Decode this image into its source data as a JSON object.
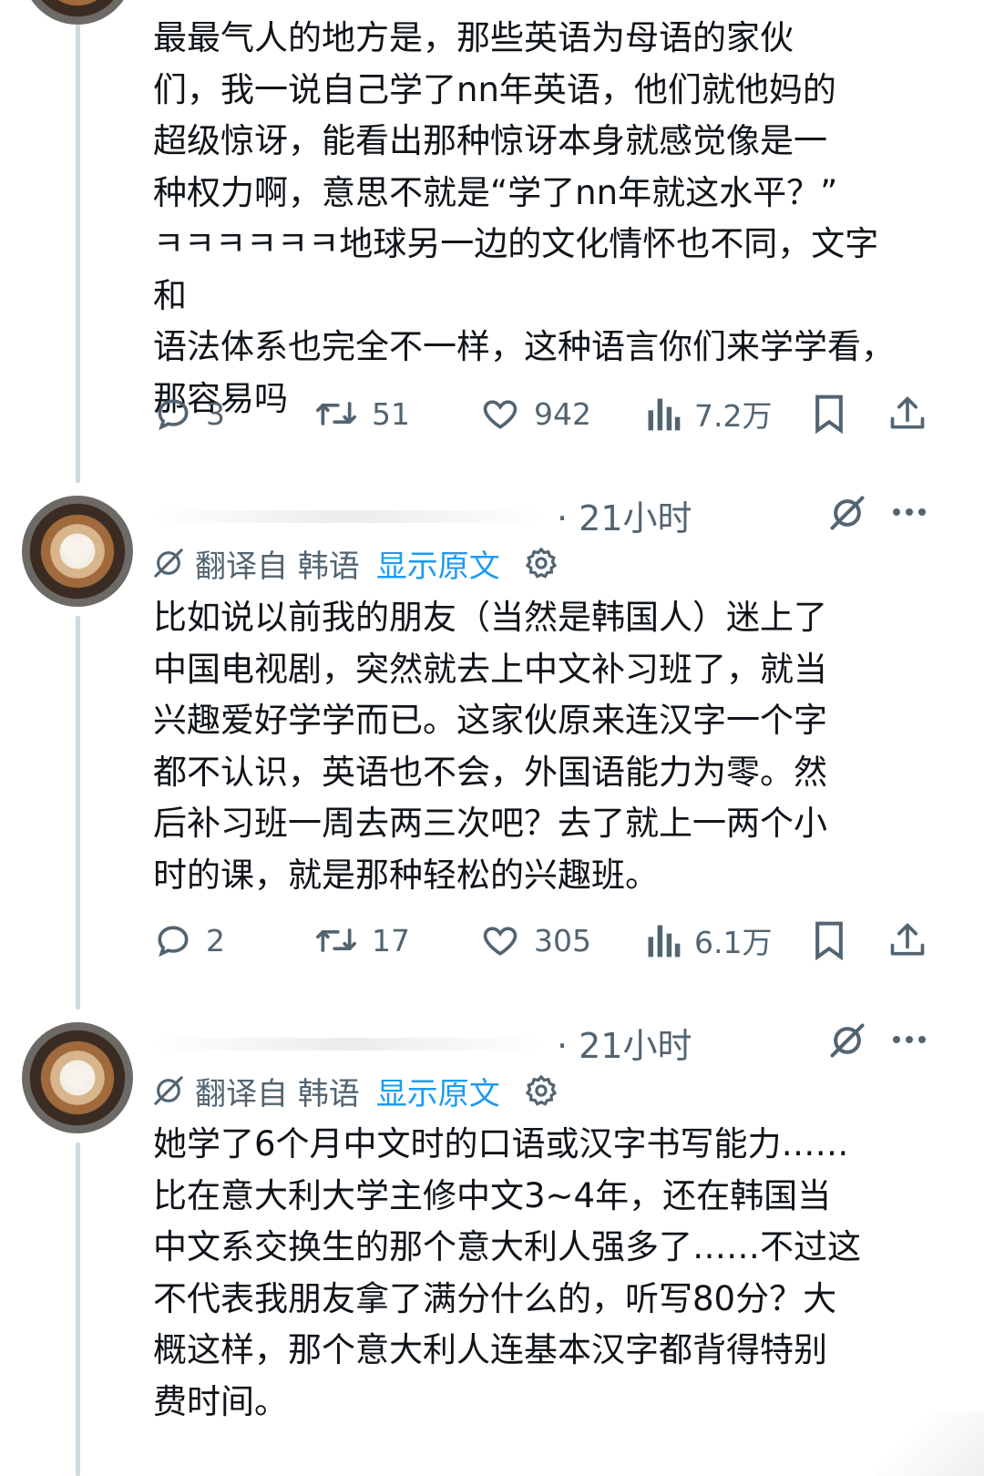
{
  "colors": {
    "text": "#0f1419",
    "muted": "#536471",
    "link": "#1d9bf0",
    "thread_line": "#cfd9de"
  },
  "posts": [
    {
      "lines": "最最气人的地方是，那些英语为母语的家伙\n们，我一说自己学了nn年英语，他们就他妈的\n超级惊讶，能看出那种惊讶本身就感觉像是一\n种权力啊，意思不就是“学了nn年就这水平？”\nㅋㅋㅋㅋㅋㅋ地球另一边的文化情怀也不同，文字和\n语法体系也完全不一样，这种语言你们来学学看，\n那容易吗",
      "stats": {
        "replies": "3",
        "reposts": "51",
        "likes": "942",
        "views": "7.2万"
      }
    },
    {
      "timestamp": "· 21小时",
      "translation": {
        "label": "翻译自 韩语",
        "show_original": "显示原文"
      },
      "lines": "比如说以前我的朋友（当然是韩国人）迷上了\n中国电视剧，突然就去上中文补习班了，就当\n兴趣爱好学学而已。这家伙原来连汉字一个字\n都不认识，英语也不会，外国语能力为零。然\n后补习班一周去两三次吧？去了就上一两个小\n时的课，就是那种轻松的兴趣班。",
      "stats": {
        "replies": "2",
        "reposts": "17",
        "likes": "305",
        "views": "6.1万"
      }
    },
    {
      "timestamp": "· 21小时",
      "translation": {
        "label": "翻译自 韩语",
        "show_original": "显示原文"
      },
      "lines": "她学了6个月中文时的口语或汉字书写能力……\n比在意大利大学主修中文3~4年，还在韩国当\n中文系交换生的那个意大利人强多了……不过这\n不代表我朋友拿了满分什么的，听写80分？大\n概这样，那个意大利人连基本汉字都背得特别\n费时间。"
    }
  ],
  "icons": {
    "reply": "reply-icon",
    "repost": "repost-icon",
    "like": "heart-icon",
    "views": "views-icon",
    "bookmark": "bookmark-icon",
    "share": "share-icon",
    "grok": "grok-icon",
    "more": "more-icon",
    "translate": "translate-icon",
    "settings": "gear-icon"
  }
}
